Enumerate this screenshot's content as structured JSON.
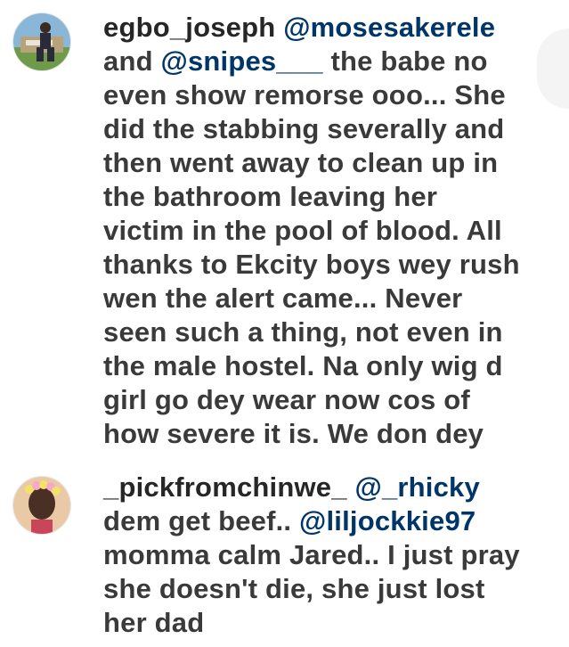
{
  "comments": [
    {
      "username": "egbo_joseph",
      "avatar_icon": "user-photo-avatar",
      "lines": [
        [
          {
            "t": "u",
            "v": "egbo_joseph"
          },
          {
            "t": "s",
            "v": " "
          },
          {
            "t": "m",
            "v": "@mosesakerele"
          }
        ],
        [
          {
            "t": "s",
            "v": "and "
          },
          {
            "t": "m",
            "v": "@snipes___"
          },
          {
            "t": "s",
            "v": " the babe no"
          }
        ],
        [
          {
            "t": "s",
            "v": "even show remorse ooo... She"
          }
        ],
        [
          {
            "t": "s",
            "v": "did the stabbing severally and"
          }
        ],
        [
          {
            "t": "s",
            "v": "then went away to clean up in"
          }
        ],
        [
          {
            "t": "s",
            "v": "the bathroom leaving her"
          }
        ],
        [
          {
            "t": "s",
            "v": "victim in the pool of blood. All"
          }
        ],
        [
          {
            "t": "s",
            "v": "thanks to Ekcity boys wey rush"
          }
        ],
        [
          {
            "t": "s",
            "v": "wen the alert came... Never"
          }
        ],
        [
          {
            "t": "s",
            "v": "seen such a thing, not even in"
          }
        ],
        [
          {
            "t": "s",
            "v": "the male hostel. Na only wig d"
          }
        ],
        [
          {
            "t": "s",
            "v": "girl go dey wear now cos of"
          }
        ],
        [
          {
            "t": "s",
            "v": "how severe it is. We don dey"
          }
        ]
      ]
    },
    {
      "username": "_pickfromchinwe_",
      "avatar_icon": "user-photo-avatar",
      "lines": [
        [
          {
            "t": "u",
            "v": "_pickfromchinwe_"
          },
          {
            "t": "s",
            "v": " "
          },
          {
            "t": "m",
            "v": "@_rhicky"
          }
        ],
        [
          {
            "t": "s",
            "v": "dem get beef.. "
          },
          {
            "t": "m",
            "v": "@liljockkie97"
          }
        ],
        [
          {
            "t": "s",
            "v": "momma calm Jared.. I just pray"
          }
        ],
        [
          {
            "t": "s",
            "v": "she doesn't die, she just lost"
          }
        ],
        [
          {
            "t": "s",
            "v": "her dad"
          }
        ]
      ]
    }
  ],
  "colors": {
    "username": "#262626",
    "mention": "#003569",
    "text": "#3a3a3a",
    "background": "#ffffff"
  }
}
